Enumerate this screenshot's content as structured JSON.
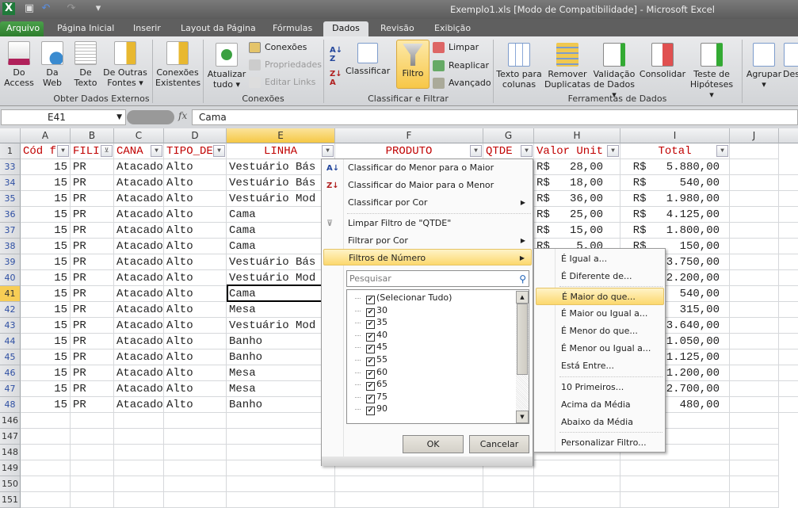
{
  "window": {
    "title": "Exemplo1.xls  [Modo de Compatibilidade]  -  Microsoft Excel"
  },
  "quick_access": [
    "excel-icon",
    "save-icon",
    "undo-icon",
    "redo-icon",
    "customize-icon"
  ],
  "tabs": [
    {
      "label": "Arquivo"
    },
    {
      "label": "Página Inicial"
    },
    {
      "label": "Inserir"
    },
    {
      "label": "Layout da Página"
    },
    {
      "label": "Fórmulas"
    },
    {
      "label": "Dados",
      "active": true
    },
    {
      "label": "Revisão"
    },
    {
      "label": "Exibição"
    }
  ],
  "ribbon": {
    "groups": [
      "Obter Dados Externos",
      "Conexões",
      "Classificar e Filtrar",
      "Ferramentas de Dados"
    ],
    "get_data": [
      {
        "l1": "Do",
        "l2": "Access"
      },
      {
        "l1": "Da",
        "l2": "Web"
      },
      {
        "l1": "De",
        "l2": "Texto"
      },
      {
        "l1": "De Outras",
        "l2": "Fontes ▾"
      },
      {
        "l1": "Conexões",
        "l2": "Existentes"
      }
    ],
    "refresh": {
      "l1": "Atualizar",
      "l2": "tudo ▾"
    },
    "connections": [
      "Conexões",
      "Propriedades",
      "Editar Links"
    ],
    "sort": "Classificar",
    "filter": "Filtro",
    "filter_small": [
      "Limpar",
      "Reaplicar",
      "Avançado"
    ],
    "tools": [
      {
        "l1": "Texto para",
        "l2": "colunas"
      },
      {
        "l1": "Remover",
        "l2": "Duplicatas"
      },
      {
        "l1": "Validação",
        "l2": "de Dados ▾"
      },
      {
        "l1": "Consolidar",
        "l2": ""
      },
      {
        "l1": "Teste de",
        "l2": "Hipóteses ▾"
      }
    ],
    "outline": [
      {
        "l1": "Agrupar",
        "l2": "▾"
      },
      {
        "l1": "Des",
        "l2": ""
      }
    ]
  },
  "formula_bar": {
    "name_box": "E41",
    "fx": "fx",
    "value": "Cama"
  },
  "columns": [
    "A",
    "B",
    "C",
    "D",
    "E",
    "F",
    "G",
    "H",
    "I",
    "J"
  ],
  "selected_column": "E",
  "header_row": {
    "num": "1",
    "cells": [
      "Cód f",
      "FILI",
      "CANA",
      "TIPO_DE",
      "LINHA",
      "PRODUTO",
      "QTDE",
      "Valor Unit",
      "Total"
    ]
  },
  "rows": [
    {
      "n": "33",
      "a": "15",
      "b": "PR",
      "c": "Atacado",
      "d": "Alto",
      "e": "Vestuário Bás",
      "h": "R$   28,00",
      "i": "R$   5.880,00"
    },
    {
      "n": "34",
      "a": "15",
      "b": "PR",
      "c": "Atacado",
      "d": "Alto",
      "e": "Vestuário Bás",
      "h": "R$   18,00",
      "i": "R$     540,00"
    },
    {
      "n": "35",
      "a": "15",
      "b": "PR",
      "c": "Atacado",
      "d": "Alto",
      "e": "Vestuário Mod",
      "h": "R$   36,00",
      "i": "R$   1.980,00"
    },
    {
      "n": "36",
      "a": "15",
      "b": "PR",
      "c": "Atacado",
      "d": "Alto",
      "e": "Cama",
      "h": "R$   25,00",
      "i": "R$   4.125,00"
    },
    {
      "n": "37",
      "a": "15",
      "b": "PR",
      "c": "Atacado",
      "d": "Alto",
      "e": "Cama",
      "h": "R$   15,00",
      "i": "R$   1.800,00"
    },
    {
      "n": "38",
      "a": "15",
      "b": "PR",
      "c": "Atacado",
      "d": "Alto",
      "e": "Cama",
      "h": "R$    5,00",
      "i": "R$     150,00"
    },
    {
      "n": "39",
      "a": "15",
      "b": "PR",
      "c": "Atacado",
      "d": "Alto",
      "e": "Vestuário Bás",
      "h": "",
      "i": "3.750,00"
    },
    {
      "n": "40",
      "a": "15",
      "b": "PR",
      "c": "Atacado",
      "d": "Alto",
      "e": "Vestuário Mod",
      "h": "",
      "i": "2.200,00"
    },
    {
      "n": "41",
      "a": "15",
      "b": "PR",
      "c": "Atacado",
      "d": "Alto",
      "e": "Cama",
      "h": "",
      "i": "540,00"
    },
    {
      "n": "42",
      "a": "15",
      "b": "PR",
      "c": "Atacado",
      "d": "Alto",
      "e": "Mesa",
      "h": "",
      "i": "315,00"
    },
    {
      "n": "43",
      "a": "15",
      "b": "PR",
      "c": "Atacado",
      "d": "Alto",
      "e": "Vestuário Mod",
      "h": "",
      "i": "3.640,00"
    },
    {
      "n": "44",
      "a": "15",
      "b": "PR",
      "c": "Atacado",
      "d": "Alto",
      "e": "Banho",
      "h": "",
      "i": "1.050,00"
    },
    {
      "n": "45",
      "a": "15",
      "b": "PR",
      "c": "Atacado",
      "d": "Alto",
      "e": "Banho",
      "h": "",
      "i": "1.125,00"
    },
    {
      "n": "46",
      "a": "15",
      "b": "PR",
      "c": "Atacado",
      "d": "Alto",
      "e": "Mesa",
      "h": "",
      "i": "1.200,00"
    },
    {
      "n": "47",
      "a": "15",
      "b": "PR",
      "c": "Atacado",
      "d": "Alto",
      "e": "Mesa",
      "h": "",
      "i": "2.700,00"
    },
    {
      "n": "48",
      "a": "15",
      "b": "PR",
      "c": "Atacado",
      "d": "Alto",
      "e": "Banho",
      "h": "",
      "i": "480,00"
    }
  ],
  "empty_rows": [
    "146",
    "147",
    "148",
    "149",
    "150",
    "151"
  ],
  "filter_menu": {
    "items": [
      "Classificar do Menor para o Maior",
      "Classificar do Maior para o Menor",
      "Classificar por Cor",
      "Limpar Filtro de \"QTDE\"",
      "Filtrar por Cor",
      "Filtros de Número"
    ],
    "search_placeholder": "Pesquisar",
    "values": [
      "(Selecionar Tudo)",
      "30",
      "35",
      "40",
      "45",
      "55",
      "60",
      "65",
      "75",
      "90"
    ],
    "ok": "OK",
    "cancel": "Cancelar"
  },
  "number_filters": [
    "É Igual a...",
    "É Diferente de...",
    "É Maior do que...",
    "É Maior ou Igual a...",
    "É Menor do que...",
    "É Menor ou Igual a...",
    "Está Entre...",
    "10 Primeiros...",
    "Acima da Média",
    "Abaixo da Média",
    "Personalizar Filtro..."
  ],
  "colors": {
    "header_text": "#c00000",
    "highlight": "#fcd86e",
    "file_tab": "#2c7c2c"
  }
}
